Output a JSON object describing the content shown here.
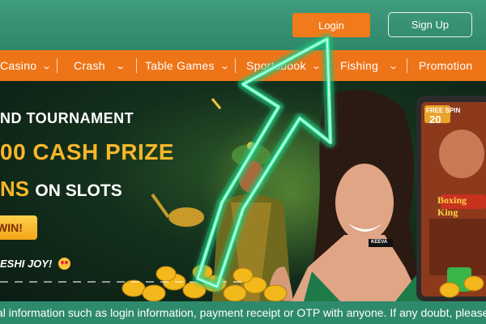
{
  "header": {
    "login_label": "Login",
    "signup_label": "Sign Up"
  },
  "nav": {
    "items": [
      {
        "label": "Casino",
        "has_dropdown": true
      },
      {
        "label": "Crash",
        "has_dropdown": true
      },
      {
        "label": "Table Games",
        "has_dropdown": true
      },
      {
        "label": "Sportsbook",
        "has_dropdown": true
      },
      {
        "label": "Fishing",
        "has_dropdown": true
      },
      {
        "label": "Promotion",
        "has_dropdown": false
      }
    ]
  },
  "banner": {
    "tournament_text": "ND TOURNAMENT",
    "prize_text": "00 CASH PRIZE",
    "spins_text": "NS",
    "slots_text": "ON SLOTS",
    "win_button_label": "WIN!",
    "joy_text": "ESHI JOY!",
    "game_badge_text": "Boxing King",
    "free_spin_text": "FREE SPIN",
    "free_spin_count": "20",
    "shirt_tag": "KEEVA"
  },
  "marquee": {
    "text": "al information such as login information, payment receipt or OTP with anyone. If any doubt, please"
  },
  "colors": {
    "header_bg": "#3a957a",
    "nav_bg": "#ee7418",
    "login_bg": "#f07a1c",
    "prize_gold": "#f7b72a",
    "arrow_neon": "#3cf0a8"
  },
  "icons": [
    "chevron-down-icon",
    "laughing-emoji-icon",
    "pointer-arrow-icon"
  ]
}
